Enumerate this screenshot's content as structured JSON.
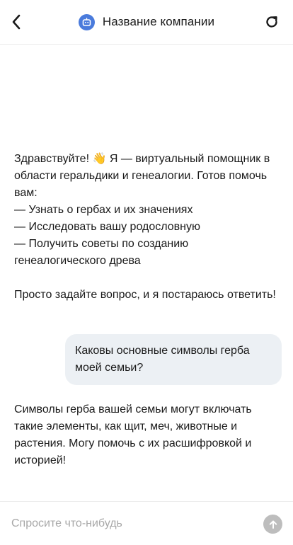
{
  "header": {
    "title": "Название компании",
    "back_icon": "chevron-left-icon",
    "refresh_icon": "refresh-icon",
    "avatar_icon": "bot-icon"
  },
  "messages": {
    "bot_greeting": "Здравствуйте! 👋 Я — виртуальный помощник в области геральдики и генеалогии. Готов помочь вам:\n— Узнать о гербах и их значениях\n— Исследовать вашу родословную\n— Получить советы по созданию генеалогического древа\n\nПросто задайте вопрос, и я постараюсь ответить!",
    "user_question": "Каковы основные символы герба моей семьи?",
    "bot_answer": "Символы герба вашей семьи могут включать такие элементы, как щит, меч, животные и растения. Могу помочь с их расшифровкой и историей!"
  },
  "composer": {
    "placeholder": "Спросите что-нибудь",
    "value": "",
    "send_icon": "arrow-up-icon"
  },
  "colors": {
    "accent": "#4a7bdc",
    "user_bubble": "#ecf0f4",
    "send_button": "#bdbdbd",
    "placeholder": "#a8a8a8"
  }
}
